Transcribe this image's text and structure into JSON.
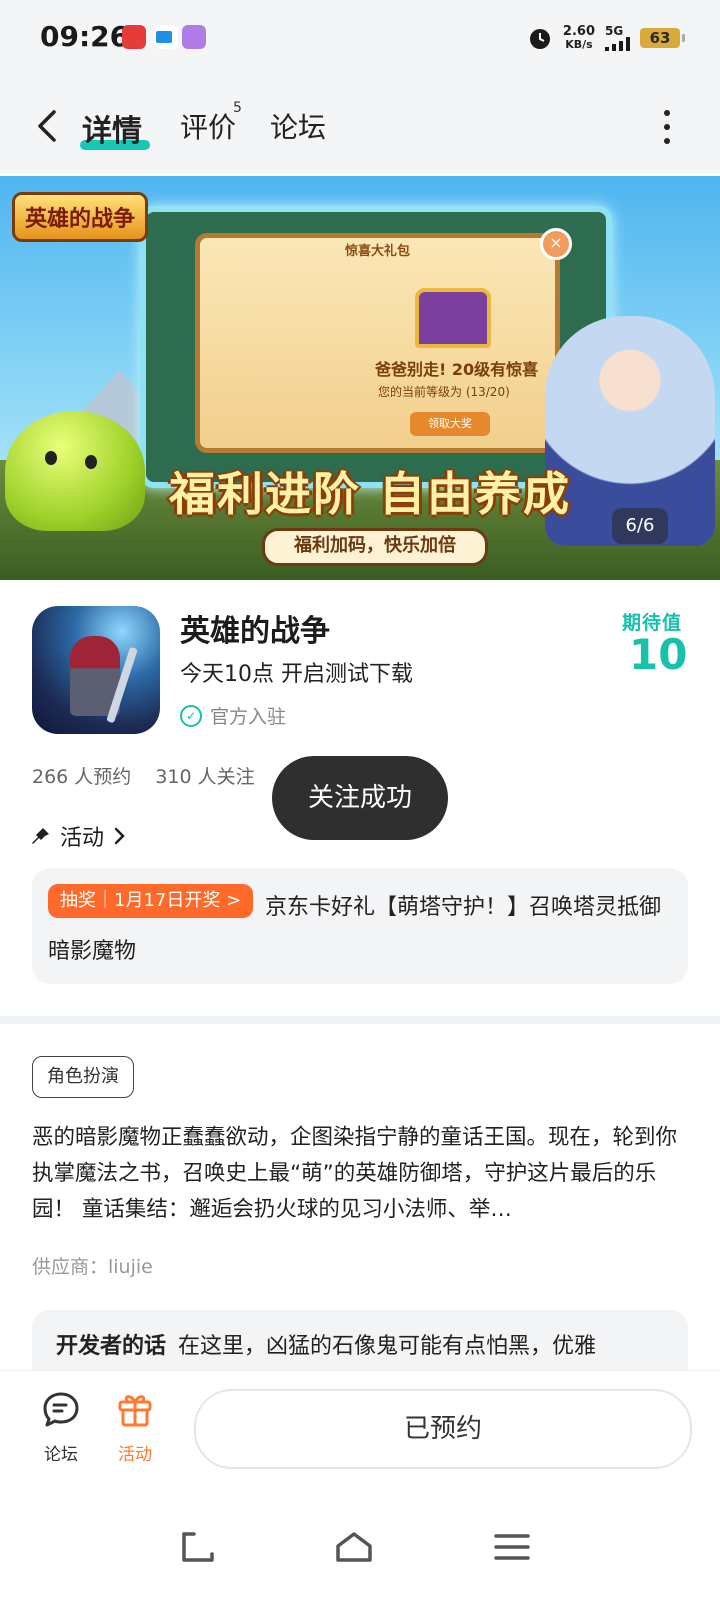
{
  "status_bar": {
    "time": "09:26",
    "net_speed_value": "2.60",
    "net_speed_unit": "KB/s",
    "network": "5G",
    "battery": "63",
    "icons": [
      "alarm-icon",
      "signal-icon",
      "battery-icon"
    ]
  },
  "header": {
    "tabs": [
      {
        "label": "详情",
        "active": true
      },
      {
        "label": "评价",
        "badge": "5"
      },
      {
        "label": "论坛"
      }
    ],
    "icons": [
      "back-icon",
      "more-icon"
    ],
    "accent_color": "#18c8b5"
  },
  "banner": {
    "logo_text": "英雄的战争",
    "popup_title": "惊喜大礼包",
    "popup_line1": "爸爸别走! 20级有惊喜",
    "popup_line2": "您的当前等级为 (13/20)",
    "popup_button": "领取大奖",
    "slogan": "福利进阶 自由养成",
    "sub_slogan": "福利加码，快乐加倍",
    "page_indicator": "6/6"
  },
  "app": {
    "name": "英雄的战争",
    "subtitle": "今天10点 开启测试下载",
    "official": "官方入驻",
    "expect_label": "期待值",
    "expect_value": "10",
    "reservations": "266 人预约",
    "followers": "310 人关注"
  },
  "toast": "关注成功",
  "activity": {
    "heading": "活动",
    "badge": "抽奖｜1月17日开奖 >",
    "text": "京东卡好礼【萌塔守护！】召唤塔灵抵御暗影魔物",
    "badge_color": "#ff6a2b"
  },
  "details": {
    "tag": "角色扮演",
    "description": "恶的暗影魔物正蠢蠢欲动，企图染指宁静的童话王国。现在，轮到你执掌魔法之书，召唤史上最“萌”的英雄防御塔，守护这片最后的乐园！ 童话集结：邂逅会扔火球的见习小法师、举…",
    "supplier": "供应商：liujie",
    "dev_title": "开发者的话",
    "dev_text": "在这里，凶猛的石像鬼可能有点怕黑，优雅"
  },
  "action_bar": {
    "forum_label": "论坛",
    "activity_label": "活动",
    "reserved_label": "已预约",
    "activity_color": "#ff7a2f"
  }
}
